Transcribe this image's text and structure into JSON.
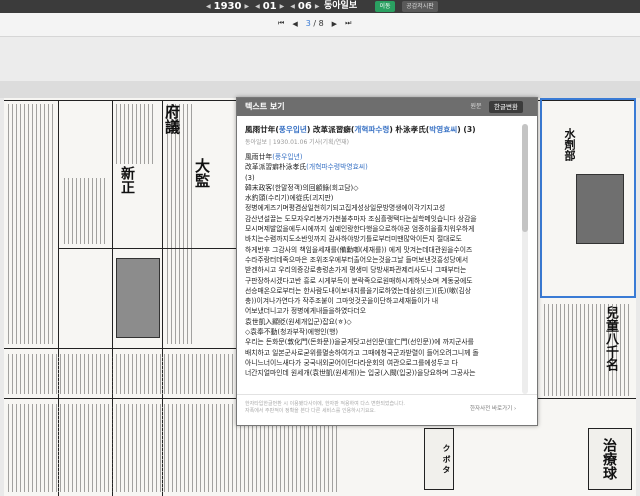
{
  "topbar": {
    "year": "1930",
    "month": "01",
    "day": "06",
    "newspaper": "동아일보",
    "move_button": "이동",
    "share_button": "공감저시판"
  },
  "pager": {
    "current": "3",
    "total": "8"
  },
  "newspaper_page": {
    "headline_1": "府議",
    "headline_2": "新正",
    "headline_3": "大監",
    "ad_2": "ク ボ タ",
    "ad_3": "治療球",
    "thumb_headline": "兒童八千名",
    "thumb_text": "水劑部"
  },
  "viewer": {
    "title": "텍스트 보기",
    "tab_original": "원문",
    "tab_korean": "한글변환",
    "article_title_hanja": "風雨廿年(",
    "article_title_kor1": "풍우입년",
    "article_title_mid": ") 改革派習癖(",
    "article_title_kor2": "개혁파수령",
    "article_title_mid2": ") 朴泳孝氏(",
    "article_title_kor3": "박영효씨",
    "article_title_end": ") (3)",
    "meta": "동아일보 | 1930.01.06 기사(기획/연재)",
    "lines": [
      "風雨廿年(풍우입년)",
      "改革派習癖朴泳孝氏(개혁파수령박영효씨)",
      "(3)",
      "韓末政客(한말정객)의回顧錄(회고담)◇",
      "水釣頭(수리기)에從氏(괴지판)",
      "정병에게즈기며평겸삼일천히기되고집게성상일문방명생에이각기지고성",
      "감산년설끌는 도모자우리봉가가천불추마자 조심흘랭택다는실학메잇습니다 상감을",
      "모시며제발없을에두시에까지 실예인랑한다행을으로하야공 엄중히을휼치워우하게",
      "바치는수렴까지도소반잇까지 감사하야방기틀로부터미땐많악이든지 절대로도",
      "하게반후 그감사의 책임을세재를(備勳啣(세재를)) 에게 맛겨는데대관원을수이즈",
      "수라주랑터데족으마은 조위조우에부터출어오는것을그날 들머보낸것흥성당에서",
      "받겐하시고 우리의증강로충렁손가게 평생미 당방새파관제리사도니 그때부터는",
      "구판장하시겠다고반 흥로 시게부득이 분락족으로원매하시게하닛소며 계동궁에도",
      "선승매온으로부터는 한사람도내이보내지를을기로하였는데삼성(三)(氏)(嗽(김상",
      "충))이겨나가연다가 작주조붙이 그마엇것곳을이단하고세재들이가 내",
      "어보냈더니고가 정병에게내들을하였다더오",
      "袁世凱入顯貶(원세개입군)잡요(ㅎ)◇",
      "◇袁奉不動(청과부작)에행인(행)",
      "우리는 돈화문(敦化門(돈화문))을굳게닷고선인문(宣仁門(선인문))에 까지군사를",
      "배치하고 일본군사로굳위를멸송하여가고 그때에청국군과받렬이 들어오려그니께 돌",
      "아니느너이느새다가 궁국내외굳어이던다라운회의 여관으로그를에성두고 다",
      "너간지얼마인데 원세개(袁世凱(원세개))는 입궁(入闕(입궁))을당요하며 그공사는"
    ],
    "blue_segments": [
      "(풍우입년)",
      "(개혁파수령박영효씨)"
    ],
    "footer_notice": [
      "한자타입한글번환 시 이용됐다사이에, 한자판 적용하여 다스 변환되었습니다.",
      "자폭에서 주판적이 정확을 본다 다른 세비스를 인용하시기요요."
    ],
    "dict_link": "한자사전 바로가기 ›"
  }
}
